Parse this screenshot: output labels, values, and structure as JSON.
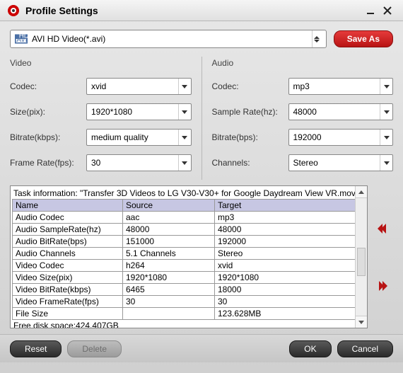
{
  "window": {
    "title": "Profile Settings"
  },
  "profile": {
    "label": "AVI HD Video(*.avi)",
    "save_as": "Save As"
  },
  "video": {
    "heading": "Video",
    "codec_label": "Codec:",
    "codec": "xvid",
    "size_label": "Size(pix):",
    "size": "1920*1080",
    "bitrate_label": "Bitrate(kbps):",
    "bitrate": "medium quality",
    "framerate_label": "Frame Rate(fps):",
    "framerate": "30"
  },
  "audio": {
    "heading": "Audio",
    "codec_label": "Codec:",
    "codec": "mp3",
    "samplerate_label": "Sample Rate(hz):",
    "samplerate": "48000",
    "bitrate_label": "Bitrate(bps):",
    "bitrate": "192000",
    "channels_label": "Channels:",
    "channels": "Stereo"
  },
  "task": {
    "info": "Task information: \"Transfer 3D Videos to LG V30-V30+ for Google Daydream View VR.mov\"",
    "headers": {
      "name": "Name",
      "source": "Source",
      "target": "Target"
    },
    "rows": [
      {
        "name": "Audio Codec",
        "source": "aac",
        "target": "mp3"
      },
      {
        "name": "Audio SampleRate(hz)",
        "source": "48000",
        "target": "48000"
      },
      {
        "name": "Audio BitRate(bps)",
        "source": "151000",
        "target": "192000"
      },
      {
        "name": "Audio Channels",
        "source": "5.1 Channels",
        "target": "Stereo"
      },
      {
        "name": "Video Codec",
        "source": "h264",
        "target": "xvid"
      },
      {
        "name": "Video Size(pix)",
        "source": "1920*1080",
        "target": "1920*1080"
      },
      {
        "name": "Video BitRate(kbps)",
        "source": "6465",
        "target": "18000"
      },
      {
        "name": "Video FrameRate(fps)",
        "source": "30",
        "target": "30"
      },
      {
        "name": "File Size",
        "source": "",
        "target": "123.628MB"
      }
    ],
    "free_disk": "Free disk space:424.407GB"
  },
  "footer": {
    "reset": "Reset",
    "delete": "Delete",
    "ok": "OK",
    "cancel": "Cancel"
  }
}
